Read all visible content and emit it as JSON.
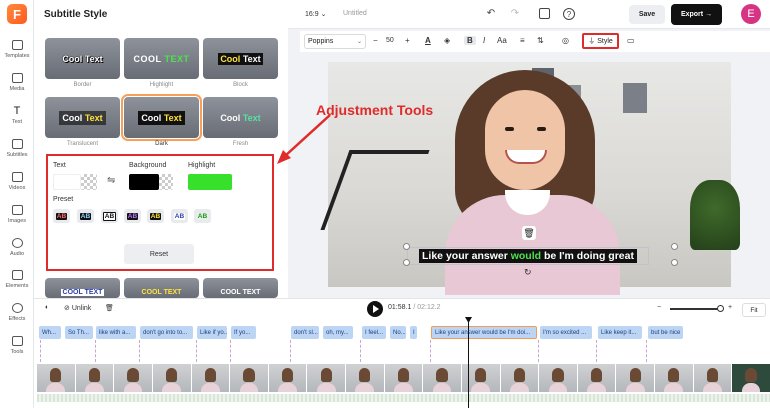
{
  "rail": {
    "logo": "F",
    "items": [
      "Templates",
      "Media",
      "Text",
      "Subtitles",
      "Videos",
      "Images",
      "Audio",
      "Elements",
      "Effects",
      "Tools"
    ]
  },
  "panel": {
    "title": "Subtitle Style",
    "styles": [
      {
        "text_a": "Cool",
        "text_b": "Text",
        "caption": "Border"
      },
      {
        "text_a": "COOL",
        "text_b": "TEXT",
        "caption": "Highlight"
      },
      {
        "text_a": "Cool",
        "text_b": "Text",
        "caption": "Block"
      },
      {
        "text_a": "Cool",
        "text_b": "Text",
        "caption": "Translucent"
      },
      {
        "text_a": "Cool",
        "text_b": "Text",
        "caption": "Dark"
      },
      {
        "text_a": "Cool",
        "text_b": "Text",
        "caption": "Fresh"
      }
    ],
    "bottom_row": [
      "COOL TEXT",
      "COOL TEXT",
      "COOL TEXT"
    ],
    "adjust": {
      "text_label": "Text",
      "background_label": "Background",
      "highlight_label": "Highlight",
      "text_color": "#ffffff",
      "background_color": "#000000",
      "highlight_color": "#37e02a",
      "preset_label": "Preset",
      "presets": [
        "AB",
        "AB",
        "AB",
        "AB",
        "AB",
        "AB",
        "AB"
      ],
      "reset_label": "Reset"
    }
  },
  "topbar": {
    "ratio": "16:9",
    "ratio_chevron": "⌄",
    "project_name": "Untitled",
    "save_label": "Save",
    "export_label": "Export",
    "export_arrow": "→",
    "avatar_initial": "E"
  },
  "toolbar": {
    "font": "Poppins",
    "size": "50",
    "minus": "−",
    "plus": "+",
    "style_label": "Style"
  },
  "annotation": "Adjustment Tools",
  "canvas": {
    "subtitle_before": "Like your answer ",
    "subtitle_highlight": "would",
    "subtitle_after": " be I'm doing great"
  },
  "timeline": {
    "split_label": "",
    "unlink_label": "Unlink",
    "current_time": "01:58.1",
    "total_time": "02:12.2",
    "separator": "/",
    "zoom_minus": "−",
    "zoom_plus": "+",
    "fit_label": "Fit",
    "clips": [
      "Wh...",
      "So Th...",
      "like with a...",
      "don't go into to...",
      "Like if yo...",
      "If yo...",
      "don't sl...",
      "oh, my...",
      "I feel...",
      "No...",
      "I",
      "Like your answer would be I'm doi...",
      "I'm so excited ...",
      "Like keep it...",
      "but be nice"
    ]
  },
  "colors": {
    "accent_red": "#e02b2b",
    "highlight_green": "#37e02a",
    "selected_outline": "#f7a05a",
    "clip_blue": "#bcd5f5"
  }
}
